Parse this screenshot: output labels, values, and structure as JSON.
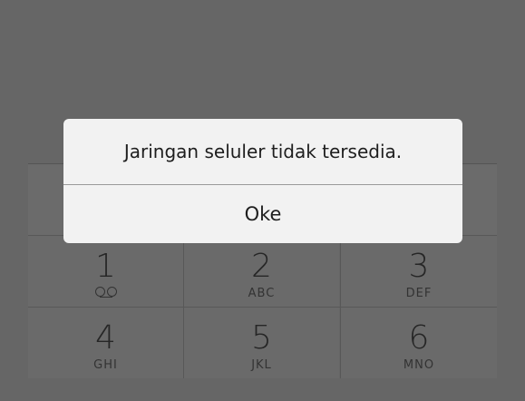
{
  "dialog": {
    "message": "Jaringan seluler tidak tersedia.",
    "ok_label": "Oke"
  },
  "keypad": {
    "keys": [
      {
        "digit": "1",
        "letters": "",
        "icon": "voicemail-icon"
      },
      {
        "digit": "2",
        "letters": "ABC"
      },
      {
        "digit": "3",
        "letters": "DEF"
      },
      {
        "digit": "4",
        "letters": "GHI"
      },
      {
        "digit": "5",
        "letters": "JKL"
      },
      {
        "digit": "6",
        "letters": "MNO"
      }
    ]
  },
  "colors": {
    "overlay": "#666666",
    "dialog_background": "#f2f2f2",
    "text": "#1e1e1e"
  }
}
